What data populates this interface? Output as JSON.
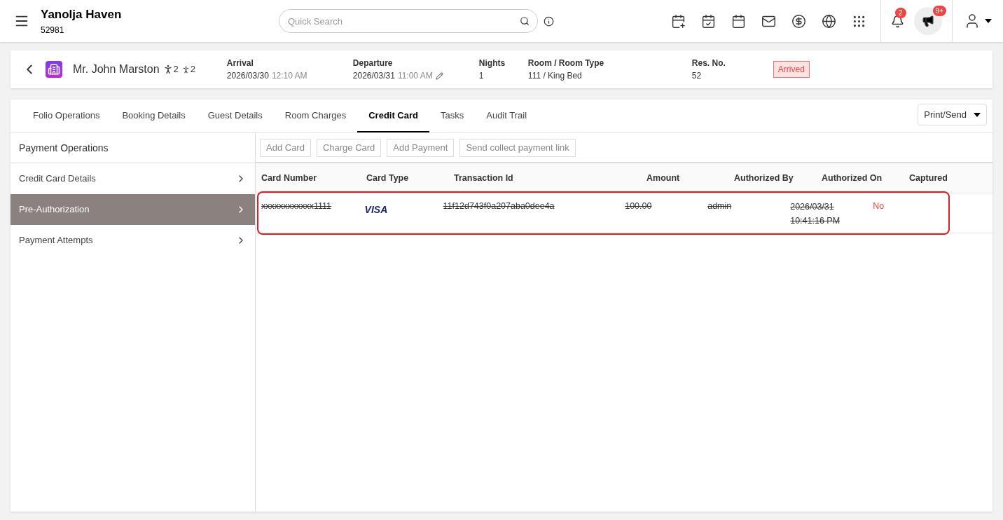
{
  "header": {
    "hotel_name": "Yanolja Haven",
    "hotel_id": "52981",
    "search": {
      "placeholder": "Quick Search"
    },
    "notifications": {
      "badge": "2"
    },
    "announcements": {
      "badge": "9+"
    }
  },
  "reservation": {
    "guest_name": "Mr. John Marston",
    "adults": "2",
    "children": "2",
    "fields": [
      {
        "label": "Arrival",
        "value": "2026/03/30",
        "time": "12:10 AM",
        "editable": false
      },
      {
        "label": "Departure",
        "value": "2026/03/31",
        "time": "11:00 AM",
        "editable": true
      },
      {
        "label": "Nights",
        "value": "1"
      },
      {
        "label": "Room / Room Type",
        "value": "111 / King Bed"
      },
      {
        "label": "Res. No.",
        "value": "52"
      }
    ],
    "status": "Arrived"
  },
  "tabs": [
    {
      "label": "Folio Operations",
      "selected": false
    },
    {
      "label": "Booking Details",
      "selected": false
    },
    {
      "label": "Guest Details",
      "selected": false
    },
    {
      "label": "Room Charges",
      "selected": false
    },
    {
      "label": "Credit Card",
      "selected": true
    },
    {
      "label": "Tasks",
      "selected": false
    },
    {
      "label": "Audit Trail",
      "selected": false
    }
  ],
  "print_send": "Print/Send",
  "sidebar": {
    "title": "Payment Operations",
    "items": [
      {
        "label": "Credit Card Details",
        "selected": false
      },
      {
        "label": "Pre-Authorization",
        "selected": true
      },
      {
        "label": "Payment Attempts",
        "selected": false
      }
    ]
  },
  "toolbar": [
    "Add Card",
    "Charge Card",
    "Add Payment",
    "Send collect payment link"
  ],
  "table": {
    "columns": [
      "Card Number",
      "Card Type",
      "Transaction Id",
      "Amount",
      "Authorized By",
      "Authorized On",
      "Captured"
    ],
    "rows": [
      {
        "voided": true,
        "highlighted": true,
        "card_number": "xxxxxxxxxxxx1111",
        "card_type": "VISA",
        "transaction_id": "11f12d743f0a207aba0dee4a",
        "amount": "100.00",
        "authorized_by": "admin",
        "authorized_on": "2026/03/31 10:41:16 PM",
        "captured": "No"
      }
    ]
  }
}
